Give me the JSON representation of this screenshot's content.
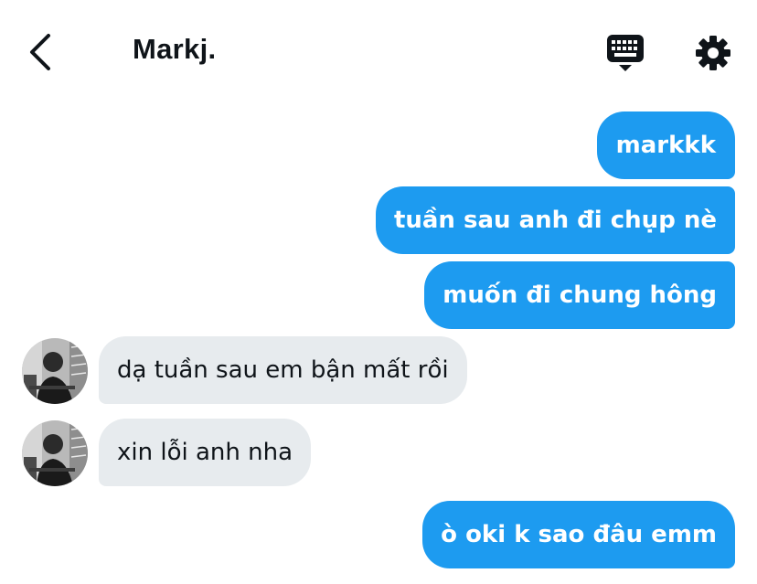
{
  "header": {
    "title": "Markj.",
    "back_icon": "chevron-left-icon",
    "keyboard_icon": "keyboard-icon",
    "settings_icon": "gear-icon"
  },
  "colors": {
    "sent_bubble": "#1d9bf0",
    "received_bubble": "#e7ebee",
    "text_dark": "#0f1419"
  },
  "messages": [
    {
      "direction": "sent",
      "text": "markkk"
    },
    {
      "direction": "sent",
      "text": "tuần sau anh đi chụp nè"
    },
    {
      "direction": "sent",
      "text": "muốn đi chung hông"
    },
    {
      "direction": "received",
      "text": "dạ tuần sau em bận mất rồi"
    },
    {
      "direction": "received",
      "text": "xin lỗi anh nha"
    },
    {
      "direction": "sent",
      "text": "ò oki k sao đâu emm"
    }
  ]
}
